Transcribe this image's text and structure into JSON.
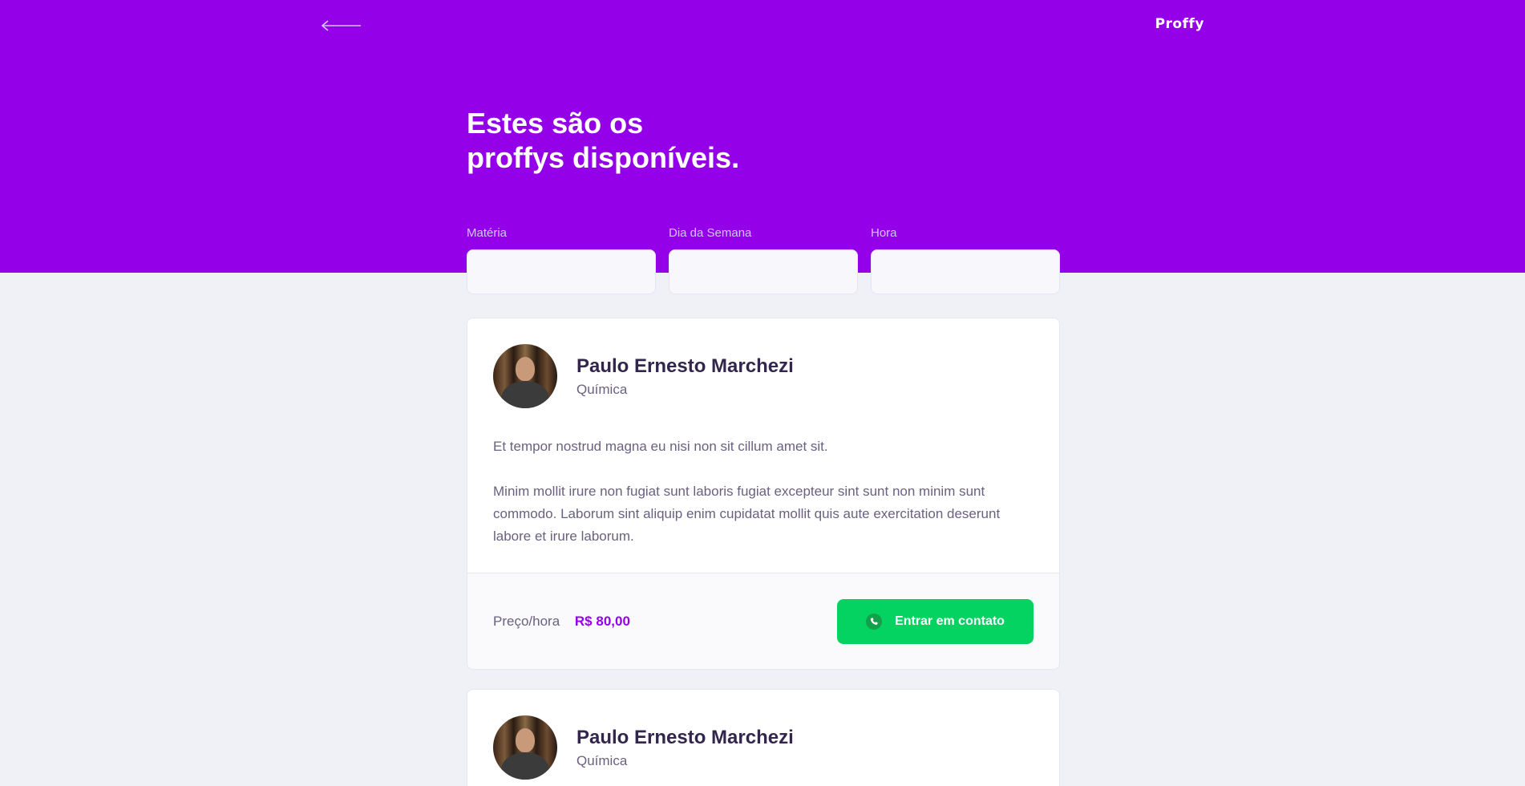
{
  "header": {
    "logo": "Proffy",
    "title_line1": "Estes são os",
    "title_line2": "proffys disponíveis."
  },
  "filters": {
    "subject_label": "Matéria",
    "weekday_label": "Dia da Semana",
    "time_label": "Hora"
  },
  "teachers": [
    {
      "name": "Paulo Ernesto Marchezi",
      "subject": "Química",
      "bio_1": "Et tempor nostrud magna eu nisi non sit cillum amet sit.",
      "bio_2": "Minim mollit irure non fugiat sunt laboris fugiat excepteur sint sunt non minim sunt commodo. Laborum sint aliquip enim cupidatat mollit quis aute exercitation deserunt labore et irure laborum.",
      "price_label": "Preço/hora",
      "price_value": "R$ 80,00",
      "contact_label": "Entrar em contato"
    },
    {
      "name": "Paulo Ernesto Marchezi",
      "subject": "Química"
    }
  ],
  "icons": {
    "back": "arrow-left-icon",
    "contact": "whatsapp-icon"
  },
  "colors": {
    "primary": "#9400E8",
    "background": "#F0F0F7",
    "secondary": "#04D361",
    "title": "#32264D",
    "text": "#6A6180"
  }
}
